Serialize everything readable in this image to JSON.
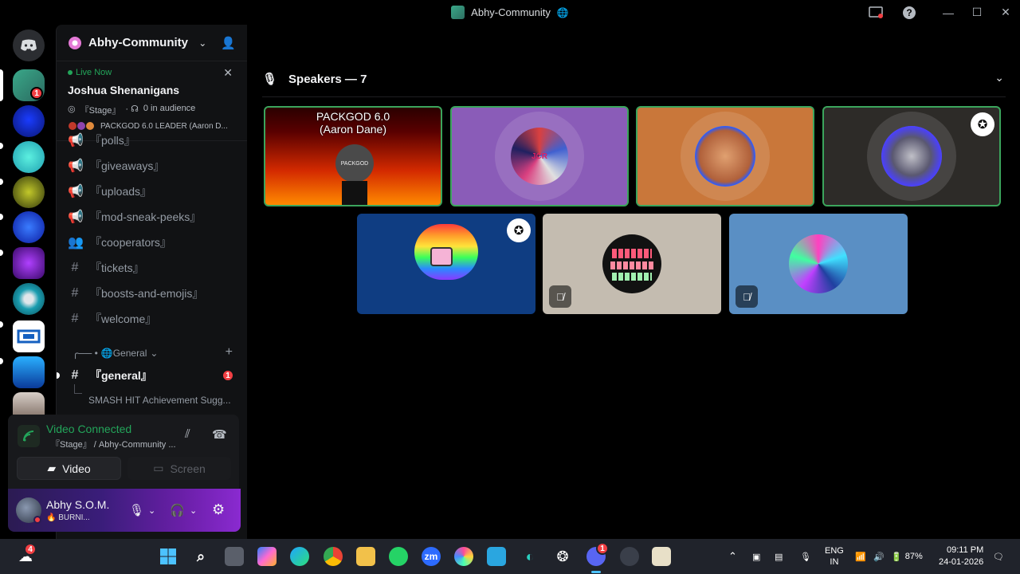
{
  "window": {
    "title": "Abhy-Community",
    "globe": "🌐"
  },
  "rail": {
    "server_badge": "1"
  },
  "server": {
    "name": "Abhy-Community ..."
  },
  "live": {
    "label": "Live Now",
    "event_name": "Joshua Shenanigans",
    "stage": "『Stage』",
    "audience": "0 in audience",
    "speaker": "PACKGOD 6.0 LEADER (Aaron D..."
  },
  "channels": {
    "partial": "『polls』",
    "items": [
      {
        "icon": "megaphone",
        "label": "『giveaways』"
      },
      {
        "icon": "megaphone",
        "label": "『uploads』"
      },
      {
        "icon": "megaphone",
        "label": "『mod-sneak-peeks』"
      },
      {
        "icon": "group",
        "label": "『cooperators』"
      },
      {
        "icon": "hash",
        "label": "『tickets』"
      },
      {
        "icon": "hash",
        "label": "『boosts-and-emojis』"
      },
      {
        "icon": "hash",
        "label": "『welcome』"
      }
    ],
    "category_prefix": "╭── •",
    "category": "🌐General",
    "general": "『general』",
    "general_badge": "1",
    "thread": "SMASH HIT Achievement Sugg..."
  },
  "voice": {
    "status": "Video Connected",
    "location": "『Stage』 / Abhy-Community ...",
    "video_label": "Video",
    "screen_label": "Screen"
  },
  "user": {
    "name": "Abhy S.O.M.",
    "status": "🔥 BURNI..."
  },
  "stage": {
    "speakers_label": "Speakers — 7",
    "tile1_title_line1": "PACKGOD 6.0",
    "tile1_title_line2": "(Aaron Dane)",
    "tile1_avatar_text": "PACKGOD",
    "tile2_avatar_text": "JCR"
  },
  "taskbar": {
    "weather_badge": "4",
    "zoom_label": "zm",
    "discord_badge": "1",
    "lang_line1": "ENG",
    "lang_line2": "IN",
    "battery": "87%",
    "time": "09:11 PM",
    "date": "24-01-2026"
  },
  "colors": {
    "speaking_border": "#3ba55c",
    "online_green": "#23a55a",
    "badge_red": "#f23f43",
    "tile2_bg": "#8a5cb8",
    "tile3_bg": "#c9773a",
    "tile4_bg": "#2d2b28",
    "tile5_bg": "#0f3d82",
    "tile6_bg": "#c4bcb0",
    "tile7_bg": "#5a8fc4"
  }
}
